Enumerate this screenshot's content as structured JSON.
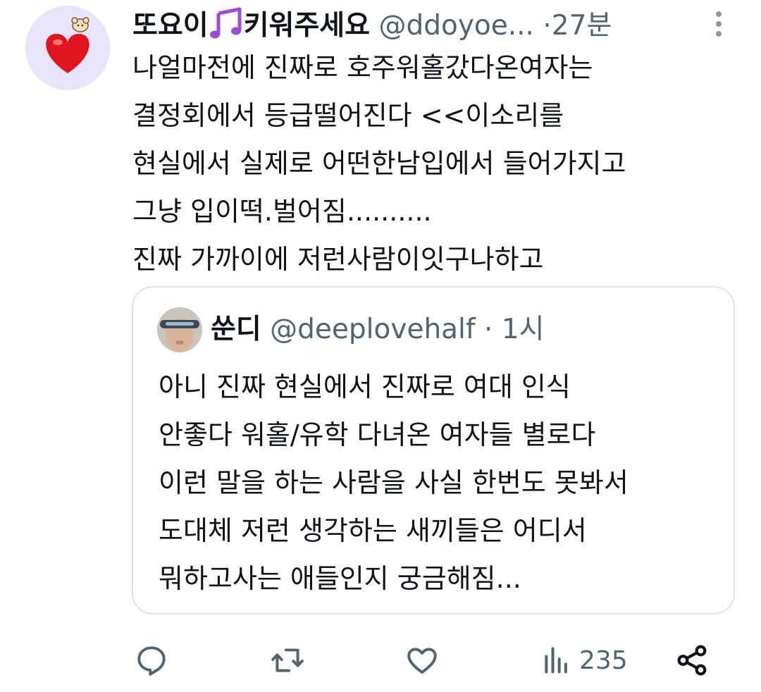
{
  "tweet": {
    "display_name": "또요이",
    "display_name_suffix": "키워주세요",
    "handle": "@ddoyoe...",
    "separator": "·",
    "time": "27분",
    "lines": [
      "나얼마전에 진짜로 호주워홀갔다온여자는",
      "결정회에서 등급떨어진다 <<이소리를",
      "현실에서 실제로 어떤한남입에서 들어가지고",
      "그냥 입이떡.벌어짐..........",
      "진짜 가까이에 저런사람이잇구나하고"
    ]
  },
  "quote": {
    "display_name": "쑨디",
    "handle": "@deeplovehalf",
    "separator": "·",
    "time": "1시",
    "lines": [
      "아니 진짜 현실에서 진짜로 여대 인식",
      "안좋다 워홀/유학 다녀온 여자들 별로다",
      "이런 말을 하는 사람을 사실 한번도 못봐서",
      "도대체 저런 생각하는 새끼들은 어디서",
      "뭐하고사는 애들인지 궁금해짐..."
    ]
  },
  "actions": {
    "views_count": "235",
    "icons": [
      "reply-icon",
      "retweet-icon",
      "like-icon",
      "views-icon",
      "share-icon"
    ]
  },
  "colors": {
    "text": "#0f1419",
    "secondary": "#536471",
    "border": "#dfe3e8",
    "avatar_bg": "#e8e4fb",
    "note_purple": "#9b4dd8",
    "heart_red": "#e0141e"
  }
}
